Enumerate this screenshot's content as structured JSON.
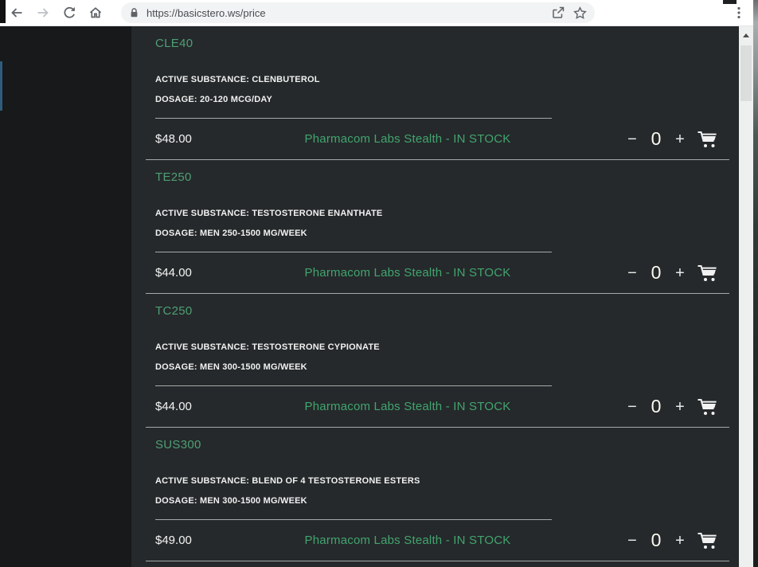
{
  "browser": {
    "url": "https://basicstero.ws/price",
    "icons": [
      "back-arrow",
      "forward-arrow",
      "reload",
      "home",
      "lock",
      "share",
      "bookmark-star",
      "kebab-menu"
    ]
  },
  "page": {
    "controls": {
      "minus": "−",
      "plus": "+",
      "cart_icon": "shopping-cart"
    },
    "products": [
      {
        "code": "CLE40",
        "active_substance": "ACTIVE SUBSTANCE: CLENBUTEROL",
        "dosage": "DOSAGE: 20-120 MCG/DAY",
        "price": "$48.00",
        "availability": "Pharmacom Labs Stealth - IN STOCK",
        "qty": "0"
      },
      {
        "code": "TE250",
        "active_substance": "ACTIVE SUBSTANCE: TESTOSTERONE ENANTHATE",
        "dosage": "DOSAGE: MEN 250-1500 MG/WEEK",
        "price": "$44.00",
        "availability": "Pharmacom Labs Stealth - IN STOCK",
        "qty": "0"
      },
      {
        "code": "TC250",
        "active_substance": "ACTIVE SUBSTANCE: TESTOSTERONE CYPIONATE",
        "dosage": "DOSAGE: MEN 300-1500 MG/WEEK",
        "price": "$44.00",
        "availability": "Pharmacom Labs Stealth - IN STOCK",
        "qty": "0"
      },
      {
        "code": "SUS300",
        "active_substance": "ACTIVE SUBSTANCE: BLEND OF 4 TESTOSTERONE ESTERS",
        "dosage": "DOSAGE: MEN 300-1500 MG/WEEK",
        "price": "$49.00",
        "availability": "Pharmacom Labs Stealth - IN STOCK",
        "qty": "0"
      }
    ]
  },
  "colors": {
    "title_green": "#4f9f74",
    "stock_green": "#41a56f",
    "content_bg": "#25292b",
    "sidebar_bg": "#17191a",
    "divider": "#bcc0be"
  }
}
